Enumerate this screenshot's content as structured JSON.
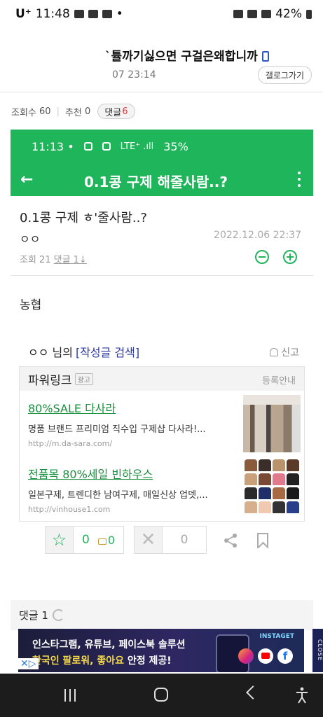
{
  "status_outer": {
    "carrier": "U⁺",
    "time": "11:48",
    "dot": "•",
    "battery": "42%"
  },
  "gall": {
    "title": "`튤까기싫으면 구걸은왜합니까",
    "date": "07 23:14",
    "gallog_button": "갤로그가기"
  },
  "stats": {
    "views_label": "조회수",
    "views": "60",
    "recommend_label": "추천",
    "recommend": "0",
    "comment_label": "댓글",
    "comment_count": "6"
  },
  "inner": {
    "time": "11:13 •",
    "signal": "LTE⁺ .ıll",
    "battery": "35%",
    "appbar_title": "0.1콩 구제 해줄사람..?",
    "post_title": "0.1콩 구제 ㅎ'줄사람..?",
    "author": "ㅇㅇ",
    "date": "2022.12.06 22:37",
    "views": "조회 21",
    "replies": "댓글 1↓",
    "body": "농협",
    "author_line": "ㅇㅇ 님의",
    "author_search": "[작성글 검색]",
    "report": "신고",
    "powerlink": {
      "title": "파워링크",
      "badge": "광고",
      "info": "등록안내",
      "ads": [
        {
          "title": "80%SALE 다사라",
          "desc": "명품 브랜드 프리미엄 직수입 구제샵 다사라!...",
          "url": "http://m.da-sara.com/"
        },
        {
          "title": "전품목 80%세일 빈하우스",
          "desc": "일본구제, 트렌디한 남여구제, 매일신상 업뎃,...",
          "url": "http://vinhouse1.com"
        }
      ]
    },
    "recommend_count": "0",
    "fix_count": "0",
    "dislike_count": "0",
    "comment_section": "댓글 1"
  },
  "ad_banner": {
    "line1": "인스타그램, 유튜브, 페이스북 솔루션",
    "line2_highlight": "한국인 팔로워, 좋아요",
    "line2_rest": " 안정 제공!",
    "brand": "INSTAGET",
    "close": "CLOSE"
  },
  "colors": {
    "green": "#1fb55a",
    "link_blue": "#2c3aa8",
    "ad_green": "#188f3c",
    "badge_red": "#e0393e"
  }
}
